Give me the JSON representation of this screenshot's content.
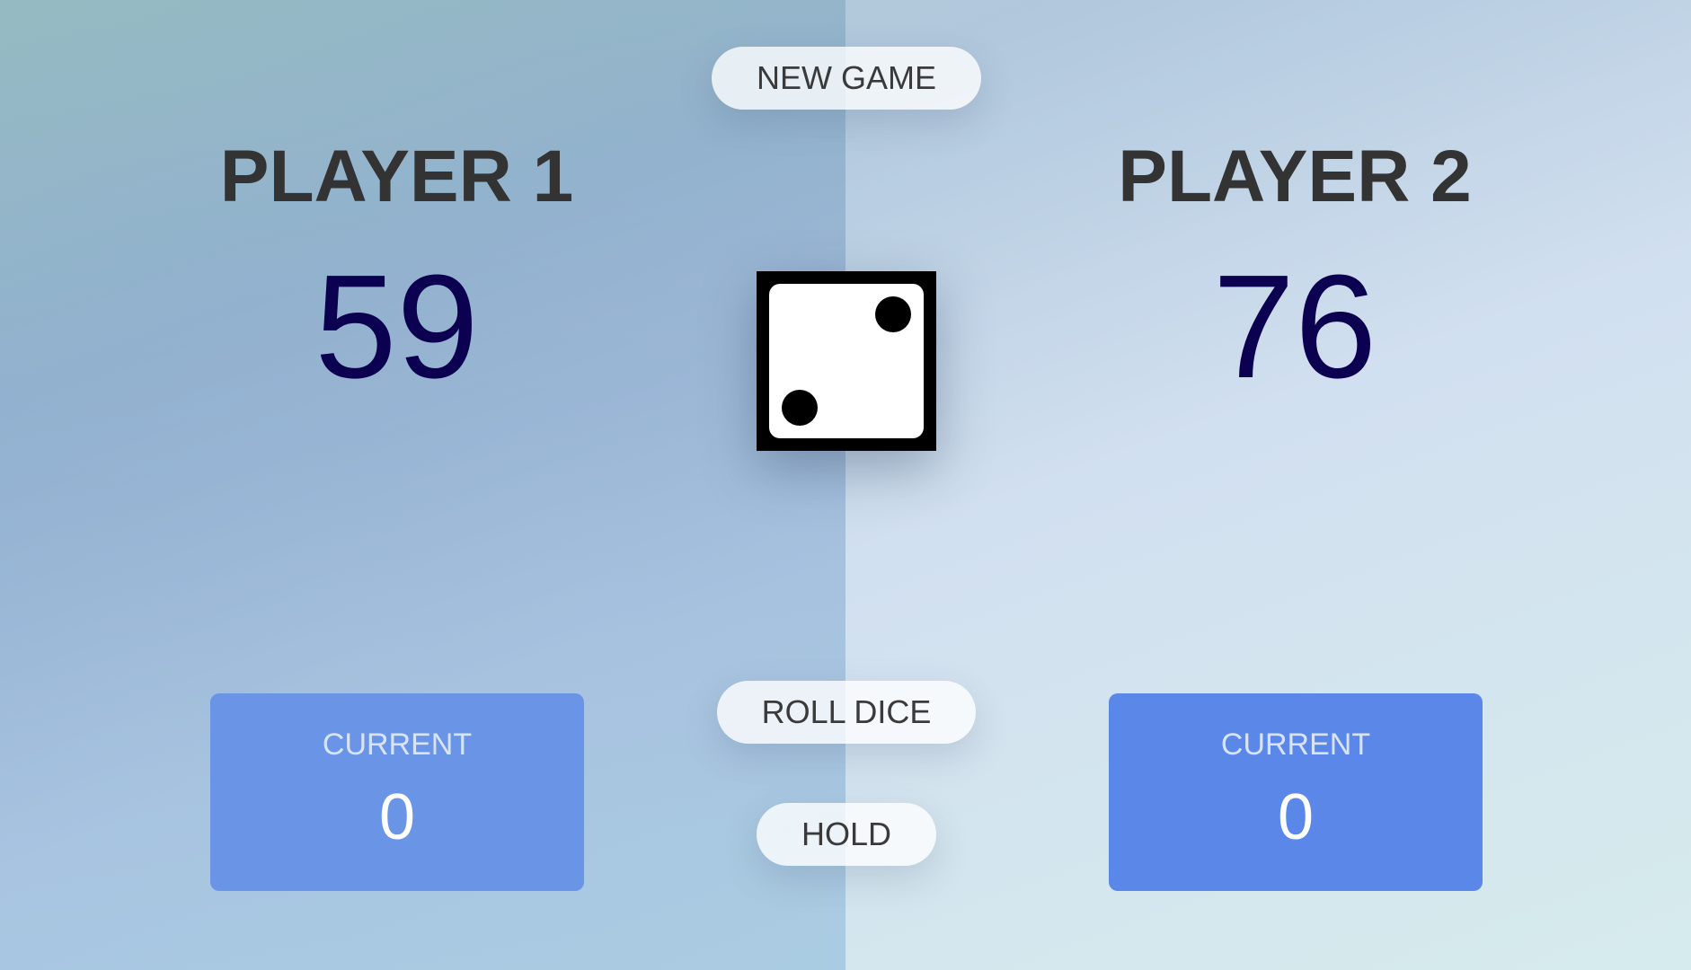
{
  "buttons": {
    "new_game": "NEW GAME",
    "roll_dice": "ROLL DICE",
    "hold": "HOLD"
  },
  "players": [
    {
      "name": "PLAYER 1",
      "score": "59",
      "current_label": "CURRENT",
      "current_value": "0"
    },
    {
      "name": "PLAYER 2",
      "score": "76",
      "current_label": "CURRENT",
      "current_value": "0"
    }
  ],
  "dice": {
    "value": 2,
    "icon": "dice-two-icon"
  },
  "colors": {
    "score_text": "#0c0050",
    "current_box_p1": "#6a94e6",
    "current_box_p2": "#5b88e8",
    "name_text": "#333333"
  }
}
